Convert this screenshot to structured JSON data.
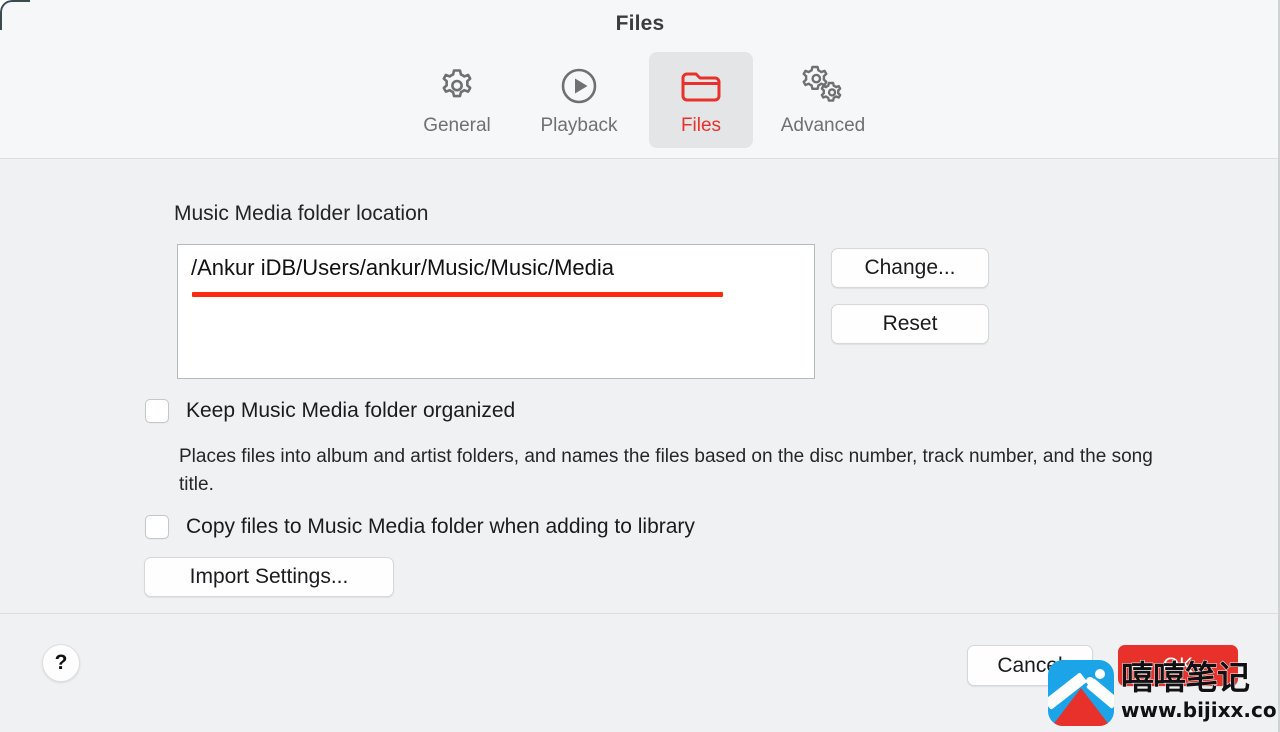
{
  "window": {
    "title": "Files"
  },
  "toolbar": {
    "tabs": [
      {
        "id": "general",
        "label": "General",
        "icon": "gear-icon",
        "selected": false
      },
      {
        "id": "playback",
        "label": "Playback",
        "icon": "play-circle-icon",
        "selected": false
      },
      {
        "id": "files",
        "label": "Files",
        "icon": "folder-icon",
        "selected": true
      },
      {
        "id": "advanced",
        "label": "Advanced",
        "icon": "double-gear-icon",
        "selected": false
      }
    ]
  },
  "main": {
    "section_label": "Music Media folder location",
    "path_value": "/Ankur iDB/Users/ankur/Music/Music/Media",
    "change_button": "Change...",
    "reset_button": "Reset",
    "checkbox_organized": {
      "label": "Keep Music Media folder organized",
      "checked": false
    },
    "organized_help": "Places files into album and artist folders, and names the files based on the disc number, track number, and the song title.",
    "checkbox_copy": {
      "label": "Copy files to Music Media folder when adding to library",
      "checked": false
    },
    "import_settings_button": "Import Settings..."
  },
  "footer": {
    "help_button": "?",
    "cancel_button": "Cancel",
    "ok_button": "OK"
  },
  "annotation": {
    "underline_color": "#fc2a10"
  },
  "watermark": {
    "brand_cn": "嘻嘻笔记",
    "url": "www.bijixx.com"
  },
  "colors": {
    "accent_red": "#e8312a",
    "toolbar_bg": "#f6f7f9",
    "content_bg": "#f0f1f3",
    "text_primary": "#1b1b1d",
    "text_muted": "#6e7072"
  }
}
